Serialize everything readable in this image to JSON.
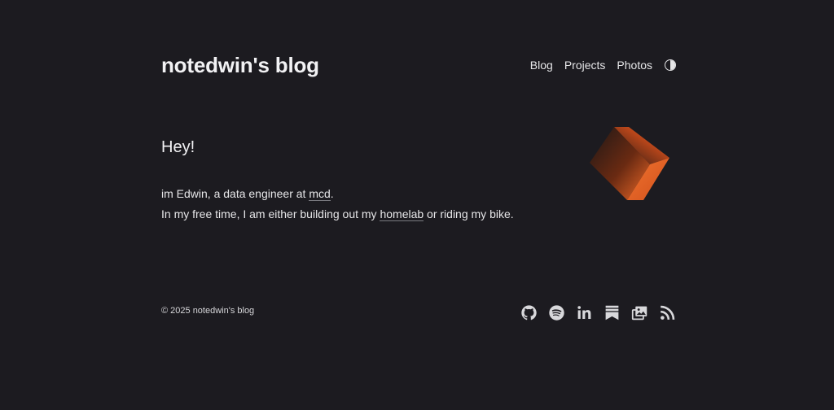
{
  "header": {
    "site_title": "notedwin's blog",
    "nav": [
      "Blog",
      "Projects",
      "Photos"
    ]
  },
  "main": {
    "greeting": "Hey!",
    "line1_prefix": "im Edwin, a data engineer at ",
    "line1_link": "mcd",
    "line1_suffix": ".",
    "line2_prefix": "In my free time, I am either building out my ",
    "line2_link": "homelab",
    "line2_suffix": " or riding my bike."
  },
  "footer": {
    "copyright": "© 2025 notedwin's blog",
    "social_icons": [
      "github-icon",
      "spotify-icon",
      "linkedin-icon",
      "bookmarks-icon",
      "photos-icon",
      "rss-icon"
    ]
  },
  "colors": {
    "background": "#1c1b20",
    "text": "#e8e8ea",
    "accent": "#f0662a"
  }
}
